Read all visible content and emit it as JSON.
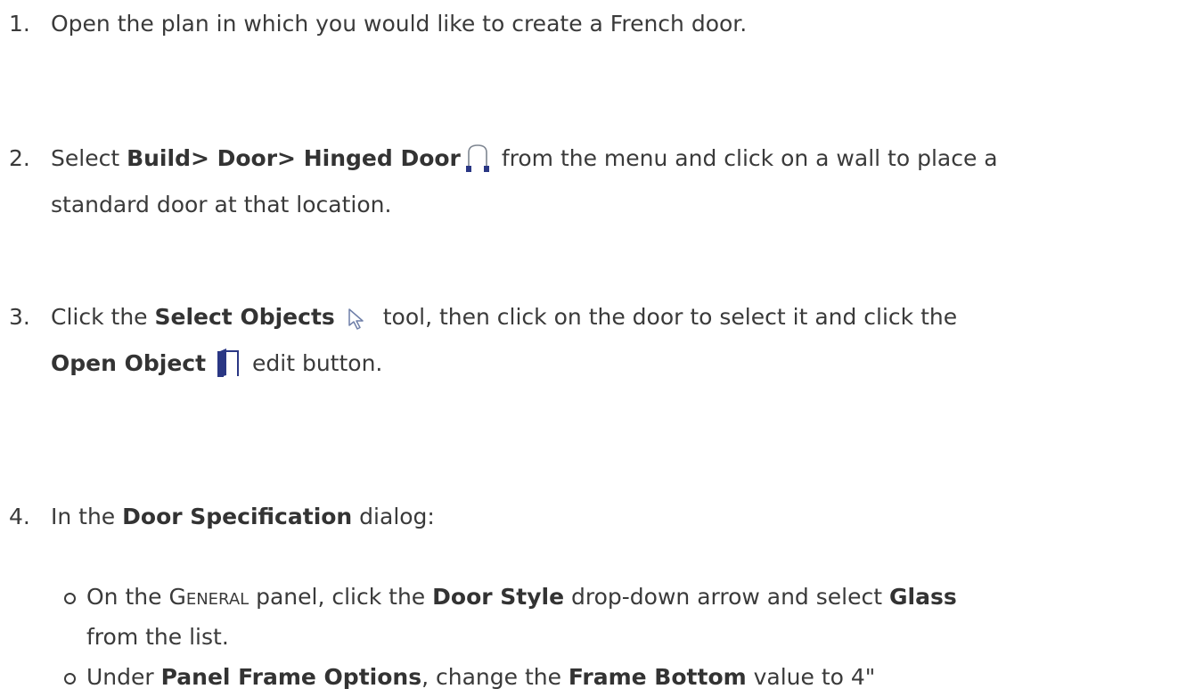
{
  "steps": [
    {
      "number": "1.",
      "text": "Open the plan in which you would like to create a French door."
    },
    {
      "number": "2.",
      "pre": "Select ",
      "bold": "Build> Door> Hinged Door",
      "post_line1": " from the menu and click on a wall to place a",
      "post_line2": "standard door at that location.",
      "icon": "hinged-door-icon"
    },
    {
      "number": "3.",
      "pre": "Click the ",
      "bold1": "Select Objects",
      "icon1": "select-objects-icon",
      "mid": " tool, then click on the door to select it and click the",
      "bold2": "Open Object",
      "icon2": "open-object-icon",
      "post": " edit button."
    },
    {
      "number": "4.",
      "pre": "In the ",
      "bold": "Door Specification",
      "post": " dialog:"
    }
  ],
  "substeps": [
    {
      "pre": "On the ",
      "panel_name": "General",
      "mid1": " panel, click the ",
      "bold1": "Door Style",
      "mid2": " drop-down arrow and select ",
      "bold2": "Glass",
      "line2": "from the list."
    },
    {
      "pre": "Under ",
      "bold1": "Panel Frame Options",
      "mid": ", change the ",
      "bold2": "Frame Bottom",
      "post": " value to 4\""
    }
  ],
  "colors": {
    "text": "#3a3a3a",
    "icon_navy": "#2a3784"
  }
}
